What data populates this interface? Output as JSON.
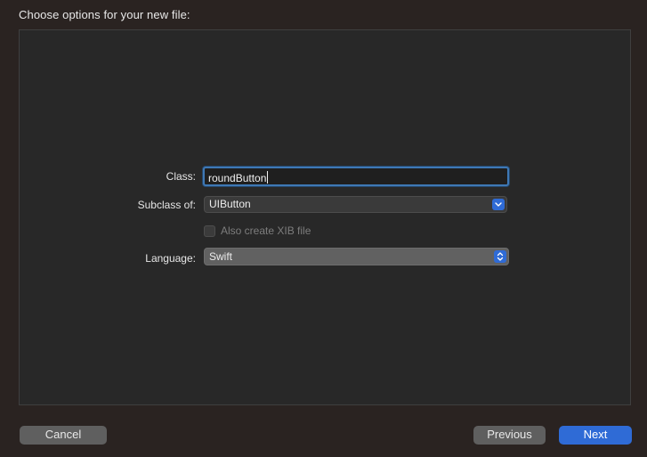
{
  "dialog": {
    "title": "Choose options for your new file:"
  },
  "form": {
    "class_label": "Class:",
    "class_value": "roundButton",
    "subclass_label": "Subclass of:",
    "subclass_value": "UIButton",
    "xib_checkbox_label": "Also create XIB file",
    "xib_checkbox_checked": false,
    "xib_checkbox_enabled": false,
    "language_label": "Language:",
    "language_value": "Swift"
  },
  "buttons": {
    "cancel": "Cancel",
    "previous": "Previous",
    "next": "Next"
  },
  "colors": {
    "accent": "#2f6bd6",
    "focus_ring": "#3e78b5",
    "window_bg": "#2a2321",
    "panel_bg": "#282828"
  },
  "icons": {
    "subclass_popup": "chevron-down-icon",
    "language_popup": "chevron-up-down-icon"
  }
}
